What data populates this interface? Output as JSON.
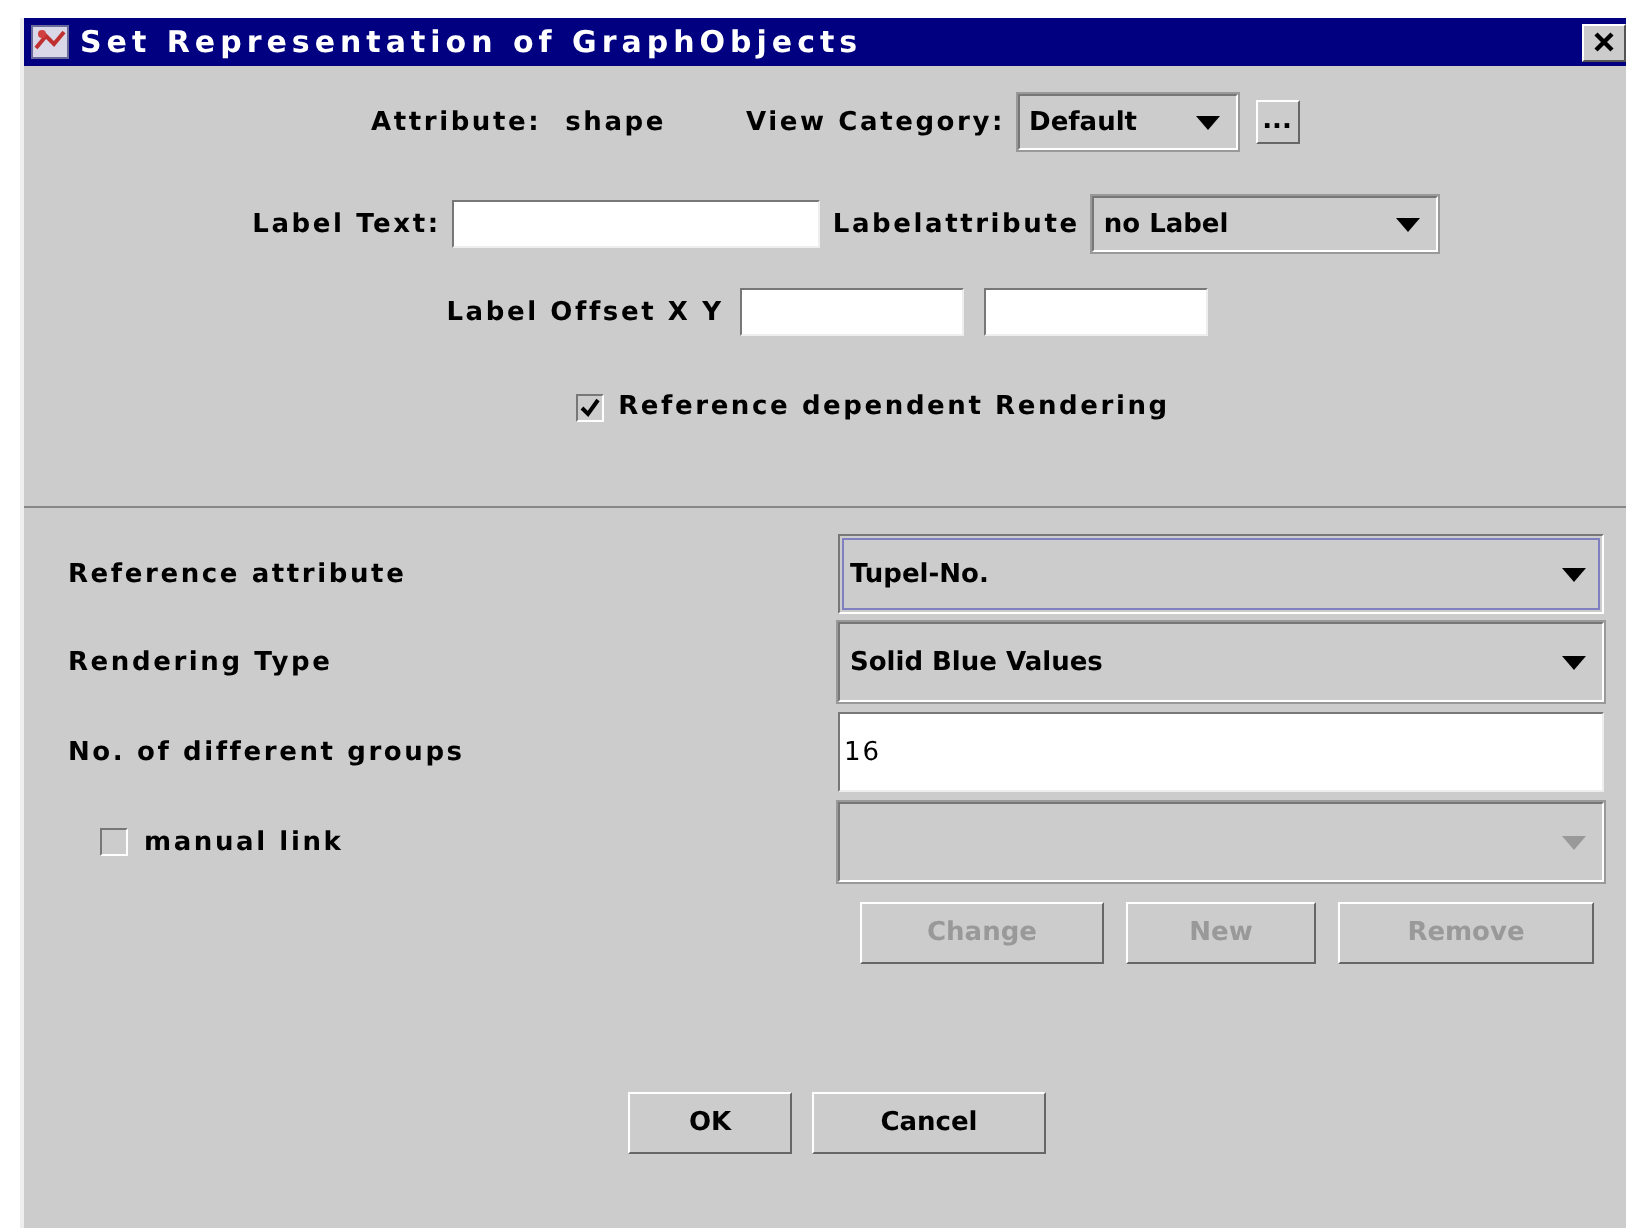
{
  "window": {
    "title": "Set Representation of GraphObjects"
  },
  "attribute": {
    "label": "Attribute:",
    "value": "shape"
  },
  "view_category": {
    "label": "View Category:",
    "value": "Default",
    "more_button": "..."
  },
  "label_text": {
    "label": "Label Text:"
  },
  "label_attribute": {
    "label": "Labelattribute",
    "value": "no Label"
  },
  "label_offset": {
    "label": "Label Offset X Y"
  },
  "reference_dependent": {
    "label": "Reference dependent Rendering",
    "checked": true
  },
  "rows": [
    {
      "kind": "combo",
      "label": "Reference attribute",
      "value": "Tupel-No.",
      "focused": true
    },
    {
      "kind": "combo",
      "label": "Rendering Type",
      "value": "Solid Blue Values",
      "focused": false
    },
    {
      "kind": "text",
      "label": "No. of different groups",
      "value": "16"
    },
    {
      "kind": "checkbox",
      "label": "manual link",
      "checked": false,
      "disabled": true
    }
  ],
  "link_buttons": [
    {
      "label": "Change",
      "disabled": true
    },
    {
      "label": "New",
      "disabled": true
    },
    {
      "label": "Remove",
      "disabled": true
    }
  ],
  "buttons": [
    "OK",
    "Cancel"
  ]
}
